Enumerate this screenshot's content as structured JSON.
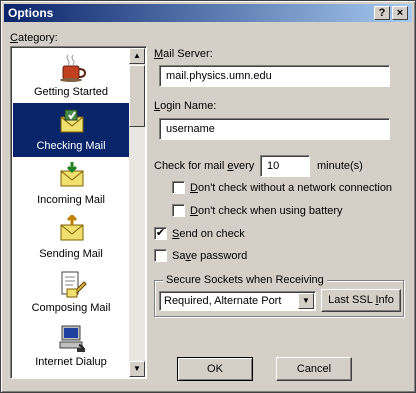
{
  "window": {
    "title": "Options",
    "help_button": "?",
    "close_button": "×"
  },
  "category": {
    "label_prefix": "",
    "label_hot": "C",
    "label_rest": "ategory:",
    "items": [
      {
        "label": "Getting Started",
        "icon": "coffee-cup-icon",
        "selected": false
      },
      {
        "label": "Checking Mail",
        "icon": "mail-check-icon",
        "selected": true
      },
      {
        "label": "Incoming Mail",
        "icon": "incoming-mail-icon",
        "selected": false
      },
      {
        "label": "Sending Mail",
        "icon": "sending-mail-icon",
        "selected": false
      },
      {
        "label": "Composing Mail",
        "icon": "composing-mail-icon",
        "selected": false
      },
      {
        "label": "Internet Dialup",
        "icon": "dialup-computer-icon",
        "selected": false
      }
    ],
    "scroll_up": "▲",
    "scroll_down": "▼"
  },
  "mail_server": {
    "label_hot": "M",
    "label_rest": "ail Server:",
    "value": "mail.physics.umn.edu"
  },
  "login_name": {
    "label_prefix": "",
    "label_hot": "L",
    "label_rest": "ogin Name:",
    "value": "username"
  },
  "check_every": {
    "label_prefix": "Check for mail ",
    "label_hot": "e",
    "label_rest": "very",
    "value": "10",
    "unit": "minute(s)"
  },
  "options": {
    "no_network": {
      "pre": "",
      "hot": "D",
      "post": "on't check without a network connection",
      "checked": false
    },
    "no_battery": {
      "pre": "",
      "hot": "D",
      "post": "on't check when using battery",
      "checked": false
    },
    "send_on_check": {
      "pre": "",
      "hot": "S",
      "post": "end on check",
      "checked": true
    },
    "save_password": {
      "pre": "Sa",
      "hot": "v",
      "post": "e password",
      "checked": false
    }
  },
  "ssl": {
    "group_title": "Secure Sockets when Receiving",
    "selected": "Required, Alternate Port",
    "last_info_pre": "Last SSL ",
    "last_info_hot": "I",
    "last_info_post": "nfo",
    "dropdown_arrow": "▼"
  },
  "buttons": {
    "ok": "OK",
    "cancel": "Cancel"
  },
  "check_mark": "✔"
}
